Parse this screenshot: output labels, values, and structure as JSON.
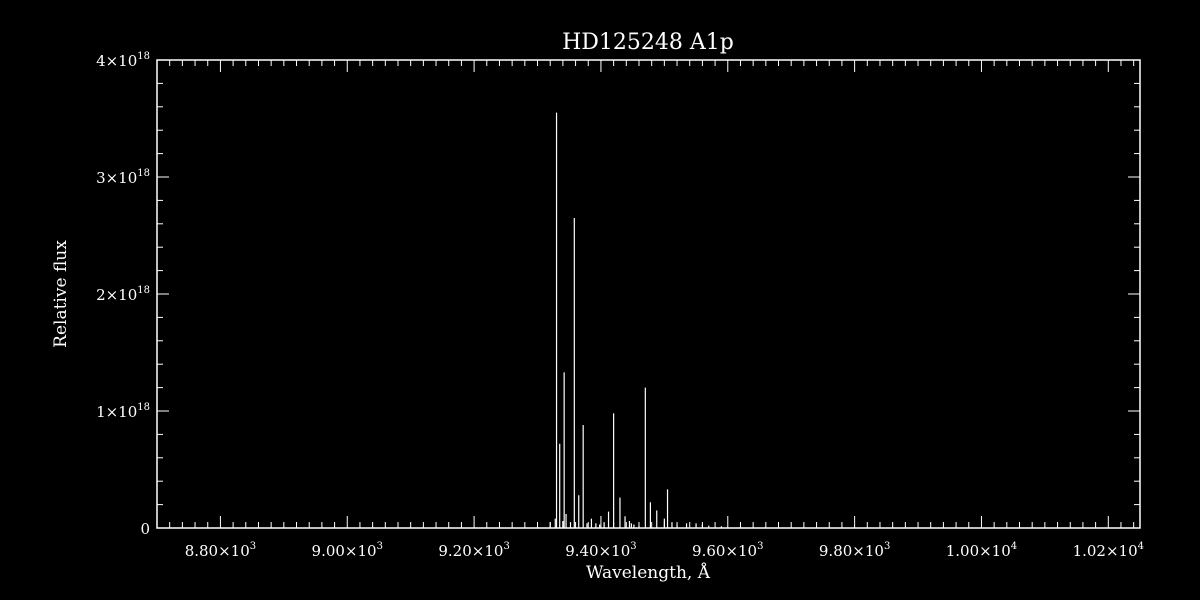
{
  "chart_data": {
    "type": "line",
    "title": "HD125248  A1p",
    "xlabel": "Wavelength, Å",
    "ylabel": "Relative flux",
    "xlim": [
      8700,
      10250
    ],
    "ylim": [
      0,
      4e+18
    ],
    "grid": false,
    "x_ticks": [
      {
        "value": 8800,
        "mantissa": "8.80",
        "exp": "3"
      },
      {
        "value": 9000,
        "mantissa": "9.00",
        "exp": "3"
      },
      {
        "value": 9200,
        "mantissa": "9.20",
        "exp": "3"
      },
      {
        "value": 9400,
        "mantissa": "9.40",
        "exp": "3"
      },
      {
        "value": 9600,
        "mantissa": "9.60",
        "exp": "3"
      },
      {
        "value": 9800,
        "mantissa": "9.80",
        "exp": "3"
      },
      {
        "value": 10000,
        "mantissa": "1.00",
        "exp": "4"
      },
      {
        "value": 10200,
        "mantissa": "1.02",
        "exp": "4"
      }
    ],
    "y_ticks": [
      {
        "value": 0,
        "label": "0"
      },
      {
        "value": 1e+18,
        "mantissa": "1",
        "exp": "18"
      },
      {
        "value": 2e+18,
        "mantissa": "2",
        "exp": "18"
      },
      {
        "value": 3e+18,
        "mantissa": "3",
        "exp": "18"
      },
      {
        "value": 4e+18,
        "mantissa": "4",
        "exp": "18"
      }
    ],
    "times_symbol": "×10",
    "series": [
      {
        "x": [
          8700,
          8900,
          9100,
          9300,
          9320,
          9328,
          9330,
          9335,
          9340,
          9342,
          9345,
          9352,
          9358,
          9365,
          9372,
          9378,
          9385,
          9392,
          9398,
          9405,
          9412,
          9420,
          9430,
          9438,
          9445,
          9448,
          9452,
          9460,
          9470,
          9478,
          9488,
          9500,
          9505,
          9512,
          9520,
          9535,
          9550,
          9560,
          9570,
          9590,
          9620,
          9700,
          9800,
          9900,
          10000,
          10100,
          10250
        ],
        "y": [
          0,
          0,
          0,
          1e+16,
          5e+16,
          8e+16,
          3.55e+18,
          7.2e+17,
          6e+16,
          1.33e+18,
          1.2e+17,
          5e+16,
          2.65e+18,
          2.8e+17,
          8.8e+17,
          4e+16,
          8e+16,
          4e+16,
          3e+16,
          5e+16,
          1.4e+17,
          9.8e+17,
          2.6e+17,
          1e+17,
          6e+16,
          4e+16,
          3e+16,
          2e+16,
          1.2e+18,
          2.2e+17,
          1.5e+17,
          8e+16,
          3.3e+17,
          5e+16,
          3e+16,
          4e+16,
          4e+16,
          3e+16,
          2e+16,
          1.5e+16,
          1e+16,
          5000000000000000.0,
          5000000000000000.0,
          5000000000000000.0,
          5000000000000000.0,
          5000000000000000.0,
          0
        ]
      }
    ]
  }
}
